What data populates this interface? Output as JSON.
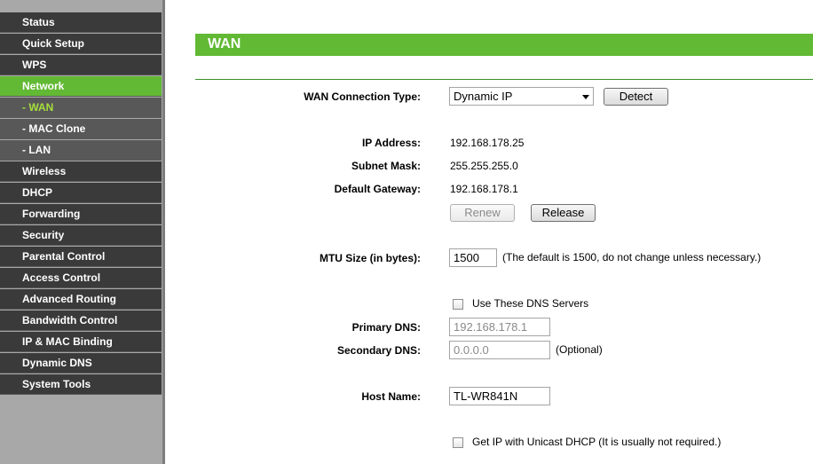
{
  "sidebar": {
    "items": [
      {
        "label": "Status"
      },
      {
        "label": "Quick Setup"
      },
      {
        "label": "WPS"
      },
      {
        "label": "Network"
      },
      {
        "label": "- WAN"
      },
      {
        "label": "- MAC Clone"
      },
      {
        "label": "- LAN"
      },
      {
        "label": "Wireless"
      },
      {
        "label": "DHCP"
      },
      {
        "label": "Forwarding"
      },
      {
        "label": "Security"
      },
      {
        "label": "Parental Control"
      },
      {
        "label": "Access Control"
      },
      {
        "label": "Advanced Routing"
      },
      {
        "label": "Bandwidth Control"
      },
      {
        "label": "IP & MAC Binding"
      },
      {
        "label": "Dynamic DNS"
      },
      {
        "label": "System Tools"
      }
    ]
  },
  "page": {
    "title": "WAN"
  },
  "wan": {
    "connection_type_label": "WAN Connection Type:",
    "connection_type_value": "Dynamic IP",
    "detect_label": "Detect",
    "ip_label": "IP Address:",
    "ip_value": "192.168.178.25",
    "subnet_label": "Subnet Mask:",
    "subnet_value": "255.255.255.0",
    "gateway_label": "Default Gateway:",
    "gateway_value": "192.168.178.1",
    "renew_label": "Renew",
    "release_label": "Release",
    "mtu_label": "MTU Size (in bytes):",
    "mtu_value": "1500",
    "mtu_hint": "(The default is 1500, do not change unless necessary.)",
    "dns_checkbox_label": "Use These DNS Servers",
    "primary_dns_label": "Primary DNS:",
    "primary_dns_value": "192.168.178.1",
    "secondary_dns_label": "Secondary DNS:",
    "secondary_dns_value": "0.0.0.0",
    "secondary_dns_hint": "(Optional)",
    "host_name_label": "Host Name:",
    "host_name_value": "TL-WR841N",
    "unicast_label": "Get IP with Unicast DHCP (It is usually not required.)"
  }
}
